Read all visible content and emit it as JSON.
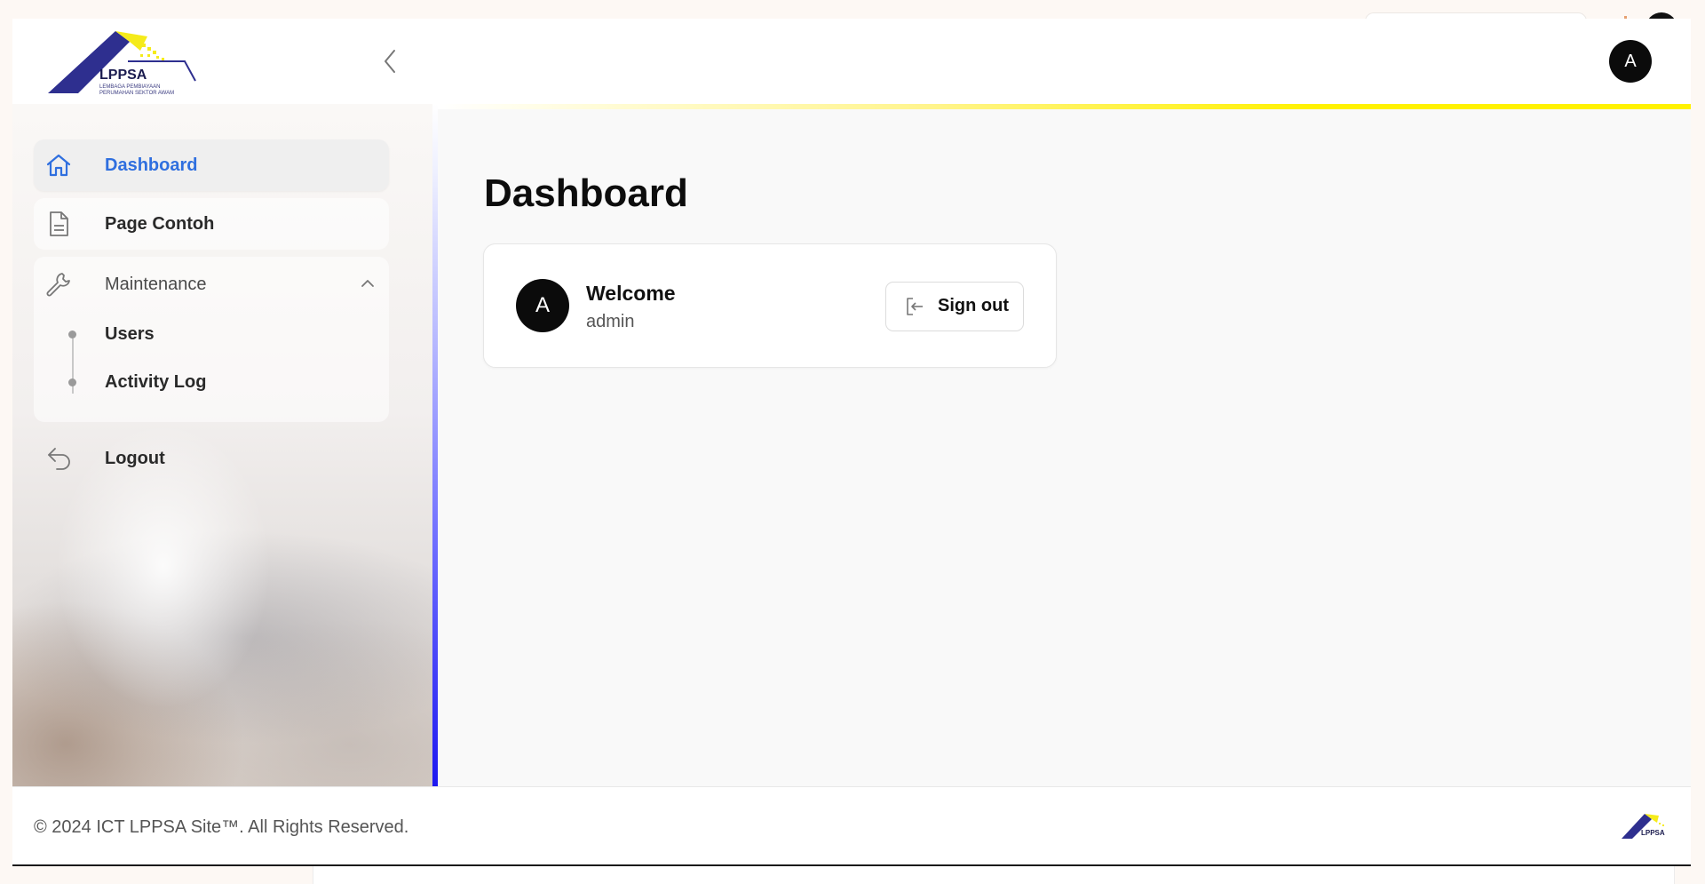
{
  "app": {
    "logo_text": "LPPSA",
    "logo_subtitle_line1": "LEMBAGA PEMBIAYAAN",
    "logo_subtitle_line2": "PERUMAHAN SEKTOR AWAM"
  },
  "header": {
    "avatar_initial": "A"
  },
  "sidebar": {
    "items": [
      {
        "label": "Dashboard",
        "icon": "home-icon",
        "active": true
      },
      {
        "label": "Page Contoh",
        "icon": "document-icon",
        "active": false
      }
    ],
    "maintenance": {
      "label": "Maintenance",
      "icon": "wrench-icon",
      "expanded": true,
      "children": [
        {
          "label": "Users"
        },
        {
          "label": "Activity Log"
        }
      ]
    },
    "logout": {
      "label": "Logout",
      "icon": "logout-arrow-icon"
    }
  },
  "main": {
    "title": "Dashboard",
    "card": {
      "avatar_initial": "A",
      "title": "Welcome",
      "subtitle": "admin",
      "signout_label": "Sign out"
    }
  },
  "footer": {
    "copyright": "© 2024 ICT LPPSA Site™. All Rights Reserved."
  },
  "colors": {
    "active_blue": "#2f6fdf",
    "accent_yellow": "#fff200",
    "sidebar_edge_blue": "#1d18f0",
    "logo_navy": "#2e2f8f"
  }
}
